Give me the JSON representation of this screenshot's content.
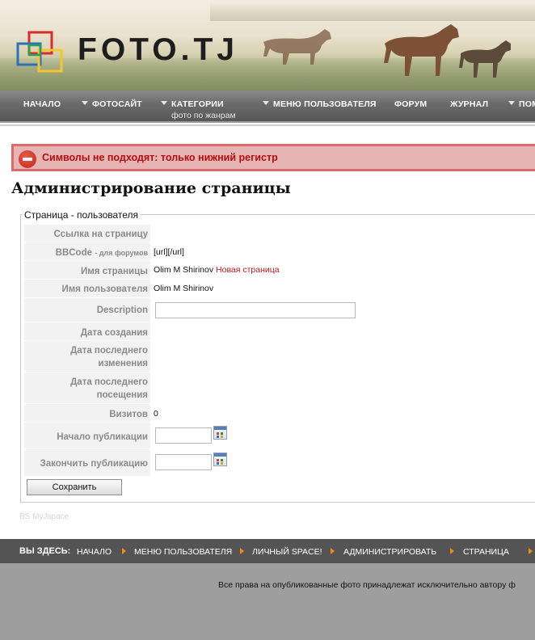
{
  "brand": {
    "logo_text": "FOTO.TJ",
    "colors": {
      "red": "#d62c2c",
      "blue": "#2f6fb8",
      "yellow": "#f2c531",
      "green": "#2aa055"
    }
  },
  "nav": {
    "items": [
      {
        "label": "НАЧАЛО",
        "has_dropdown": false
      },
      {
        "label": "ФОТОСАЙТ",
        "has_dropdown": true
      },
      {
        "label": "КАТЕГОРИИ",
        "has_dropdown": true,
        "sub": "фото по жанрам"
      },
      {
        "label": "МЕНЮ ПОЛЬЗОВАТЕЛЯ",
        "has_dropdown": true
      },
      {
        "label": "ФОРУМ",
        "has_dropdown": false
      },
      {
        "label": "ЖУРНАЛ",
        "has_dropdown": false
      },
      {
        "label": "ПОМ",
        "has_dropdown": true
      }
    ]
  },
  "error": {
    "icon": "no-entry-icon",
    "message": "Символы не подходят: только нижний регистр"
  },
  "page": {
    "title": "Администрирование страницы"
  },
  "form": {
    "legend": "Страница - пользователя",
    "rows": {
      "link": {
        "label": "Ссылка на страницу",
        "value": ""
      },
      "bbcode": {
        "label": "BBCode",
        "label_small": "- для форумов",
        "value": "[url][/url]"
      },
      "page_name": {
        "label": "Имя страницы",
        "value": "Olim M Shirinov",
        "value_extra": "Новая страница"
      },
      "user_name": {
        "label": "Имя пользователя",
        "value": "Olim M Shirinov"
      },
      "description": {
        "label": "Description",
        "value": ""
      },
      "created": {
        "label": "Дата создания",
        "value": ""
      },
      "modified": {
        "label_line1": "Дата последнего",
        "label_line2": "изменения",
        "value": ""
      },
      "visited": {
        "label_line1": "Дата последнего",
        "label_line2": "посещения",
        "value": ""
      },
      "visits": {
        "label": "Визитов",
        "value": "0"
      },
      "publish_start": {
        "label": "Начало публикации",
        "value": ""
      },
      "publish_end": {
        "label": "Закончить публикацию",
        "value": ""
      }
    },
    "save_label": "Сохранить"
  },
  "credit": "BS MyJspace",
  "breadcrumb": {
    "label": "ВЫ ЗДЕСЬ:",
    "items": [
      "НАЧАЛО",
      "МЕНЮ ПОЛЬЗОВАТЕЛЯ",
      "ЛИЧНЫЙ SPACE!",
      "АДМИНИСТРИРОВАТЬ",
      "СТРАНИЦА"
    ],
    "arrow_color": "#f08a14"
  },
  "footer": {
    "copyright": "Все права на опубликованные фото принадлежат исключительно автору ф"
  }
}
